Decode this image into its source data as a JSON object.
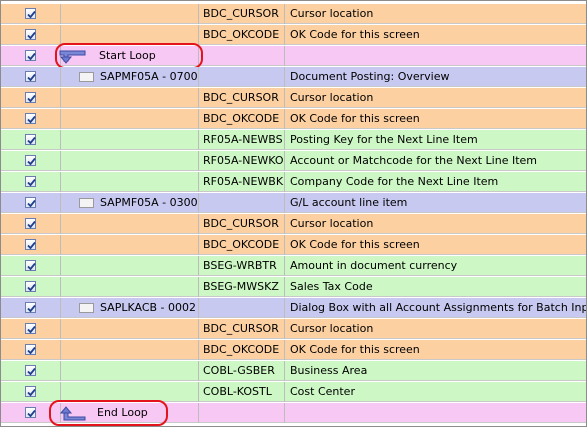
{
  "colors": {
    "orange_row": "#fdd0a2",
    "green_row": "#cdf7c5",
    "screen_row": "#c7c9f0",
    "loop_row": "#f8c8f5",
    "highlight": "#e4141c"
  },
  "rows": [
    {
      "type": "field",
      "color": "orange",
      "checked": true,
      "field": "BDC_CURSOR",
      "desc": "Cursor location"
    },
    {
      "type": "field",
      "color": "orange",
      "checked": true,
      "field": "BDC_OKCODE",
      "desc": "OK Code for this screen"
    },
    {
      "type": "loop",
      "checked": true,
      "label": "Start Loop",
      "icon": "loop-start-arrow-icon",
      "highlighted": true
    },
    {
      "type": "screen",
      "checked": true,
      "program": "SAPMF05A - 0700",
      "desc": "Document Posting: Overview"
    },
    {
      "type": "field",
      "color": "orange",
      "checked": true,
      "field": "BDC_CURSOR",
      "desc": "Cursor location"
    },
    {
      "type": "field",
      "color": "orange",
      "checked": true,
      "field": "BDC_OKCODE",
      "desc": "OK Code for this screen"
    },
    {
      "type": "field",
      "color": "green",
      "checked": true,
      "field": "RF05A-NEWBS",
      "desc": "Posting Key for the Next Line Item"
    },
    {
      "type": "field",
      "color": "green",
      "checked": true,
      "field": "RF05A-NEWKO",
      "desc": "Account or Matchcode for the Next Line Item"
    },
    {
      "type": "field",
      "color": "green",
      "checked": true,
      "field": "RF05A-NEWBK",
      "desc": "Company Code for the Next Line Item"
    },
    {
      "type": "screen",
      "checked": true,
      "program": "SAPMF05A - 0300",
      "desc": "G/L account line item"
    },
    {
      "type": "field",
      "color": "orange",
      "checked": true,
      "field": "BDC_CURSOR",
      "desc": "Cursor location"
    },
    {
      "type": "field",
      "color": "orange",
      "checked": true,
      "field": "BDC_OKCODE",
      "desc": "OK Code for this screen"
    },
    {
      "type": "field",
      "color": "green",
      "checked": true,
      "field": "BSEG-WRBTR",
      "desc": "Amount in document currency"
    },
    {
      "type": "field",
      "color": "green",
      "checked": true,
      "field": "BSEG-MWSKZ",
      "desc": "Sales Tax Code"
    },
    {
      "type": "screen",
      "checked": true,
      "program": "SAPLKACB - 0002",
      "desc": "Dialog Box with all Account Assignments for Batch Input"
    },
    {
      "type": "field",
      "color": "orange",
      "checked": true,
      "field": "BDC_CURSOR",
      "desc": "Cursor location"
    },
    {
      "type": "field",
      "color": "orange",
      "checked": true,
      "field": "BDC_OKCODE",
      "desc": "OK Code for this screen"
    },
    {
      "type": "field",
      "color": "green",
      "checked": true,
      "field": "COBL-GSBER",
      "desc": "Business Area"
    },
    {
      "type": "field",
      "color": "green",
      "checked": true,
      "field": "COBL-KOSTL",
      "desc": "Cost Center"
    },
    {
      "type": "loop",
      "checked": true,
      "label": "End Loop",
      "icon": "loop-end-arrow-icon",
      "highlighted": true
    }
  ]
}
